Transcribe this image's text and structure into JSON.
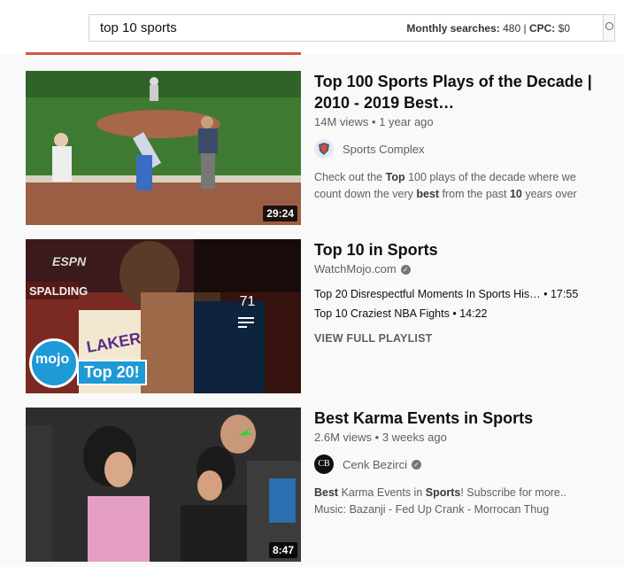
{
  "search": {
    "query": "top 10 sports",
    "monthly_label": "Monthly searches:",
    "monthly_value": "480",
    "cpc_label": "CPC:",
    "cpc_value": "$0"
  },
  "results": [
    {
      "title": "Top 100 Sports Plays of the Decade | 2010 - 2019 Best…",
      "views": "14M views",
      "age": "1 year ago",
      "channel": "Sports Complex",
      "desc_line1_pre": "Check out the ",
      "desc_line1_b1": "Top",
      "desc_line1_post": " 100 plays of the decade where we",
      "desc_line2_pre": "count down the very ",
      "desc_line2_b1": "best",
      "desc_line2_mid": " from the past ",
      "desc_line2_b2": "10",
      "desc_line2_post": " years over",
      "duration": "29:24"
    },
    {
      "title": "Top 10 in Sports",
      "channel": "WatchMojo.com",
      "playlist_count": "71",
      "playlist_items": [
        {
          "title": "Top 20 Disrespectful Moments In Sports His…",
          "duration": "17:55"
        },
        {
          "title": "Top 10 Craziest NBA Fights",
          "duration": "14:22"
        }
      ],
      "view_full": "VIEW FULL PLAYLIST",
      "thumb_badge_brand": "mojo",
      "thumb_badge_text": "Top 20!"
    },
    {
      "title": "Best Karma Events in Sports",
      "views": "2.6M views",
      "age": "3 weeks ago",
      "channel": "Cenk Bezirci",
      "channel_initials": "CB",
      "desc_line1_b1": "Best",
      "desc_line1_mid": " Karma Events in ",
      "desc_line1_b2": "Sports",
      "desc_line1_post": "! Subscribe for more..",
      "desc_line2": "Music: Bazanji - Fed Up Crank - Morrocan Thug",
      "duration": "8:47"
    }
  ]
}
